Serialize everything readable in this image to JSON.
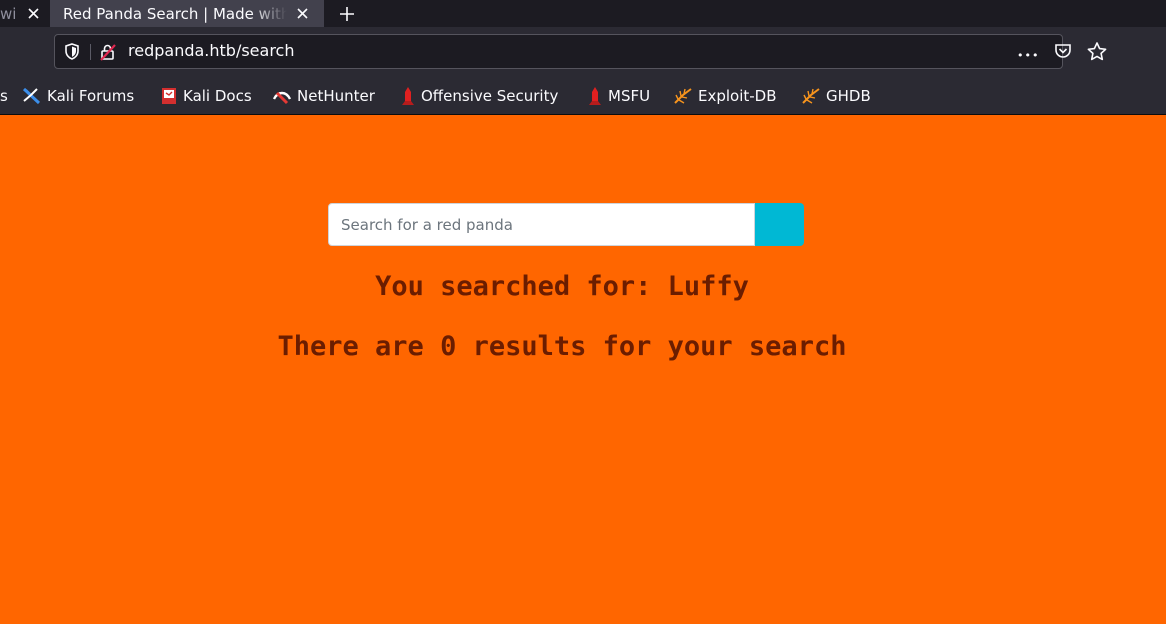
{
  "browser": {
    "tabs": [
      {
        "title": "wi",
        "close": "✕"
      },
      {
        "title": "Red Panda Search | Made with",
        "close": "✕"
      }
    ],
    "new_tab": "+",
    "url": "redpanda.htb/search",
    "page_actions": "•••",
    "bookmarks": [
      {
        "label": "s",
        "icon": "kali-icon"
      },
      {
        "label": "Kali Forums",
        "icon": "kali-forums-icon"
      },
      {
        "label": "Kali Docs",
        "icon": "kali-docs-icon"
      },
      {
        "label": "NetHunter",
        "icon": "nethunter-icon"
      },
      {
        "label": "Offensive Security",
        "icon": "offsec-icon"
      },
      {
        "label": "MSFU",
        "icon": "offsec-icon"
      },
      {
        "label": "Exploit-DB",
        "icon": "exploitdb-icon"
      },
      {
        "label": "GHDB",
        "icon": "exploitdb-icon"
      }
    ]
  },
  "page": {
    "background_color": "#ff6600",
    "search": {
      "placeholder": "Search for a red panda",
      "value": "",
      "button_color": "#00b8d4"
    },
    "searched_for": "You searched for: Luffy",
    "result_count": "There are 0 results for your search"
  }
}
